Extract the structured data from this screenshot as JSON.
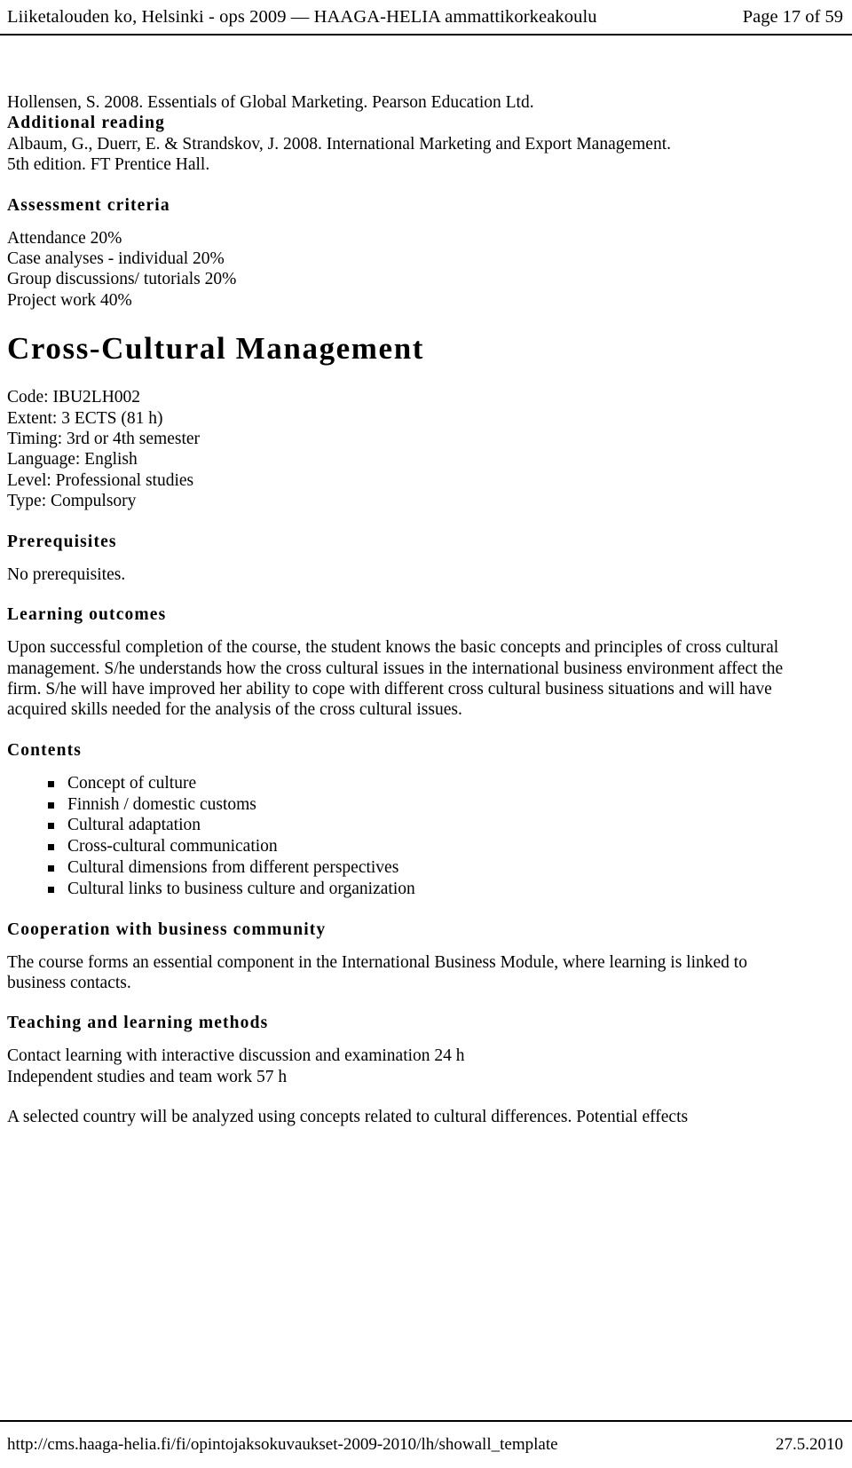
{
  "header": {
    "doc_title": "Liiketalouden ko, Helsinki - ops 2009 — HAAGA-HELIA ammattikorkeakoulu",
    "page_number": "Page 17 of 59"
  },
  "footer": {
    "url": "http://cms.haaga-helia.fi/fi/opintojaksokuvaukset-2009-2010/lh/showall_template",
    "date": "27.5.2010"
  },
  "literature": {
    "main_reference": "Hollensen, S. 2008. Essentials of Global Marketing. Pearson Education Ltd.",
    "additional_reading_heading": "Additional reading",
    "additional_reference_line1": "Albaum, G., Duerr, E. & Strandskov, J. 2008. International Marketing and Export Management.",
    "additional_reference_line2": "5th edition. FT Prentice Hall."
  },
  "assessment": {
    "heading": "Assessment criteria",
    "items": [
      "Attendance 20%",
      "Case analyses - individual 20%",
      "Group discussions/ tutorials 20%",
      "Project work 40%"
    ]
  },
  "course": {
    "title": "Cross-Cultural Management",
    "meta": [
      "Code: IBU2LH002",
      "Extent: 3 ECTS (81 h)",
      "Timing: 3rd or 4th semester",
      "Language: English",
      "Level: Professional studies",
      "Type: Compulsory"
    ]
  },
  "prerequisites": {
    "heading": "Prerequisites",
    "text": "No prerequisites."
  },
  "learning_outcomes": {
    "heading": "Learning outcomes",
    "text": "Upon successful completion of the course, the student knows the basic concepts and principles of cross cultural management. S/he understands how the cross cultural issues in the international business environment affect the firm. S/he will have improved her ability to cope with different cross cultural business situations and will have acquired skills needed for the analysis of the cross cultural issues."
  },
  "contents": {
    "heading": "Contents",
    "items": [
      "Concept of culture",
      "Finnish / domestic customs",
      "Cultural adaptation",
      "Cross-cultural communication",
      "Cultural dimensions from different perspectives",
      "Cultural links to business culture and organization"
    ]
  },
  "cooperation": {
    "heading": "Cooperation with business community",
    "text": "The course forms an essential component in the International Business Module, where learning is linked to business contacts."
  },
  "teaching": {
    "heading": "Teaching and learning methods",
    "lines": [
      "Contact learning with interactive discussion and examination 24 h",
      "Independent studies and team work 57 h"
    ],
    "closing_text": "A selected country will be analyzed using concepts related to cultural differences. Potential effects"
  }
}
